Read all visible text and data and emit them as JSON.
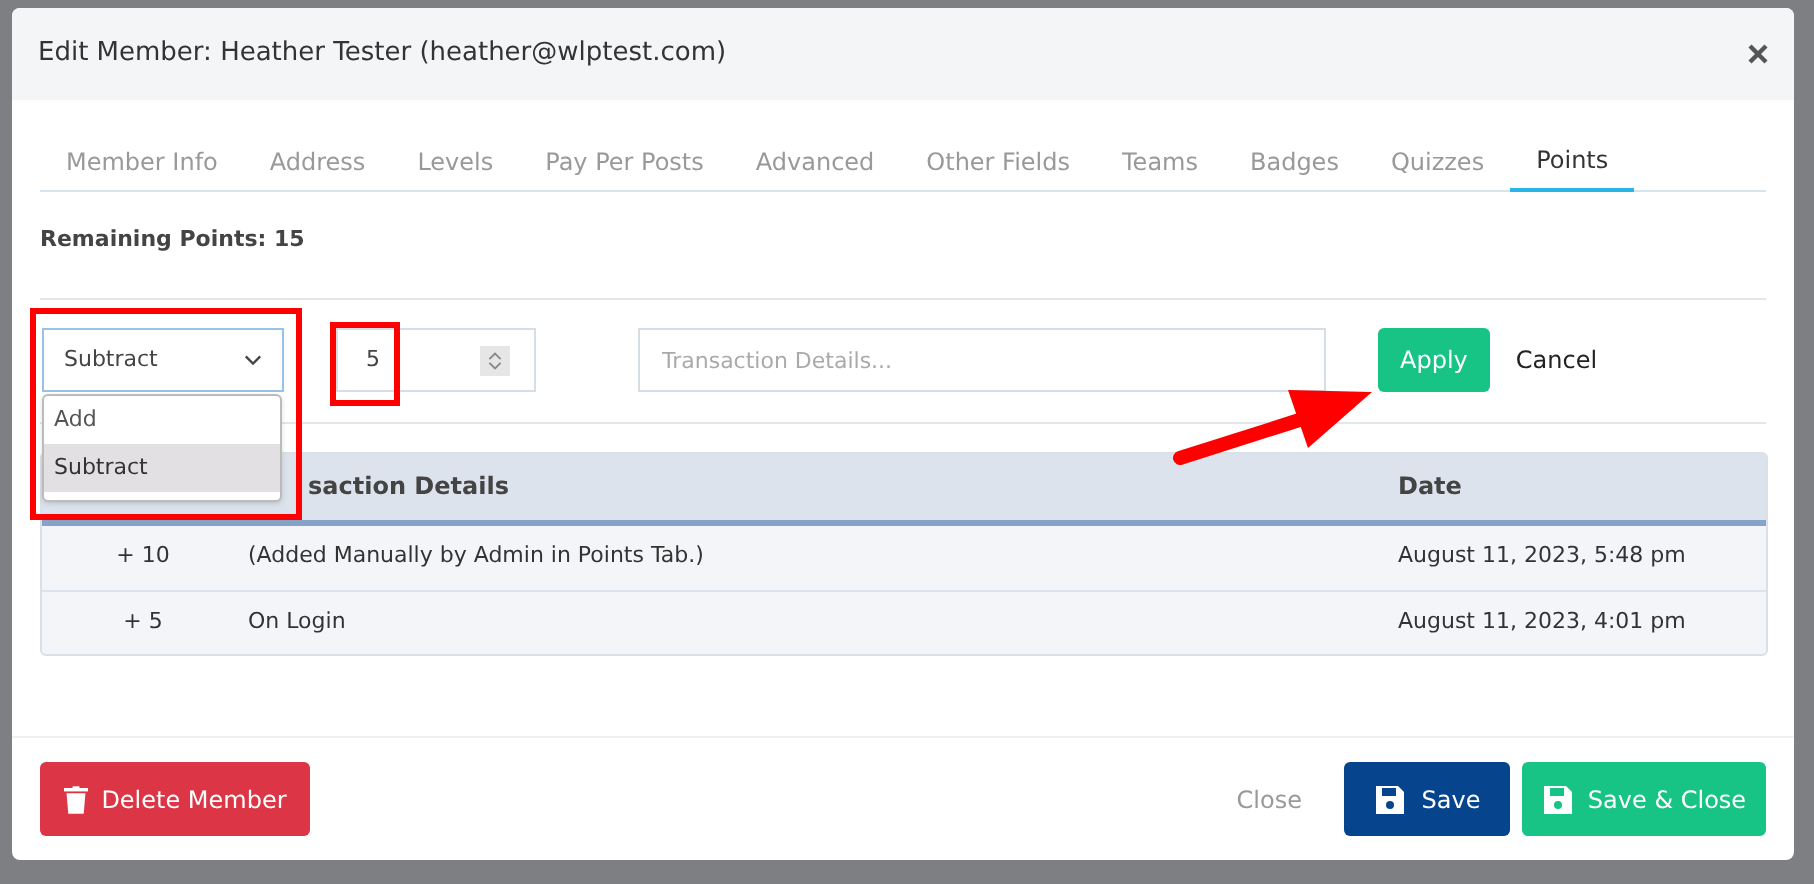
{
  "window": {
    "title": "Edit Member: Heather Tester (heather@wlptest.com)"
  },
  "tabs": [
    {
      "label": "Member Info",
      "selected": false
    },
    {
      "label": "Address",
      "selected": false
    },
    {
      "label": "Levels",
      "selected": false
    },
    {
      "label": "Pay Per Posts",
      "selected": false
    },
    {
      "label": "Advanced",
      "selected": false
    },
    {
      "label": "Other Fields",
      "selected": false
    },
    {
      "label": "Teams",
      "selected": false
    },
    {
      "label": "Badges",
      "selected": false
    },
    {
      "label": "Quizzes",
      "selected": false
    },
    {
      "label": "Points",
      "selected": true
    }
  ],
  "remaining_points": "Remaining Points: 15",
  "operation_select": {
    "value": "Subtract",
    "expanded": true,
    "options": [
      {
        "label": "Add",
        "selected": false
      },
      {
        "label": "Subtract",
        "selected": true
      }
    ]
  },
  "points_field": {
    "value": "5"
  },
  "details_field": {
    "placeholder": "Transaction Details..."
  },
  "apply_button": "Apply",
  "cancel_link": "Cancel",
  "table": {
    "columns": [
      "saction Details",
      "Date"
    ],
    "rows": [
      {
        "points": "+ 10",
        "details": "(Added Manually by Admin in Points Tab.)",
        "date": "August 11, 2023, 5:48 pm"
      },
      {
        "points": "+ 5",
        "details": "On Login",
        "date": "August 11, 2023, 4:01 pm"
      }
    ]
  },
  "footer": {
    "delete_button": "Delete Member",
    "close_link": "Close",
    "save_button": "Save",
    "save_close_button": "Save & Close"
  }
}
